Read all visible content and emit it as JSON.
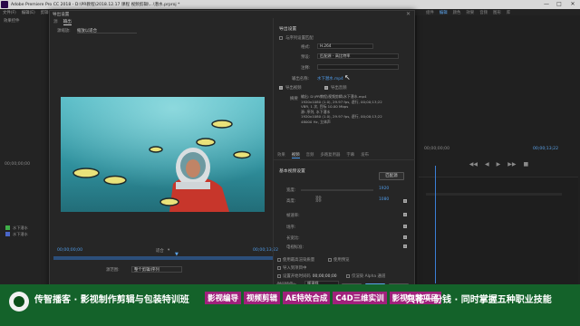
{
  "app": {
    "title": "Adobe Premiere Pro CC 2018 - D:\\PR教程\\2018.12.17 课程 视频剪辑\\...\\潜水.prproj *",
    "window_controls": [
      "—",
      "□",
      "✕"
    ]
  },
  "menu": [
    "文件(F)",
    "编辑(E)",
    "剪辑(C)",
    "序列(S)",
    "标记(M)",
    "图形(G)",
    "窗口(W)",
    "帮助(H)"
  ],
  "workspace_tabs": [
    {
      "label": "组件",
      "active": false
    },
    {
      "label": "编辑",
      "active": true
    },
    {
      "label": "颜色",
      "active": false
    },
    {
      "label": "效果",
      "active": false
    },
    {
      "label": "音频",
      "active": false
    },
    {
      "label": "图形",
      "active": false
    },
    {
      "label": "库",
      "active": false
    }
  ],
  "left_panel": {
    "tab": "效果控件",
    "timecode": "00;00;00;00",
    "project_items": [
      {
        "color": "#3fae49",
        "label": "水下潜水"
      },
      {
        "color": "#4a66c9",
        "label": "水下潜水"
      }
    ]
  },
  "right_panel": {
    "timecode_left": "00;00;00;00",
    "timecode_right": "00;00;13;22",
    "transport_icons": [
      "◀◀",
      "◀",
      "▶",
      "▶▶",
      "■"
    ]
  },
  "dialog": {
    "title": "导出设置",
    "close": "✕",
    "tabs": [
      {
        "label": "源",
        "active": false
      },
      {
        "label": "输出",
        "active": true
      }
    ],
    "source_scale": {
      "label": "源缩放:",
      "value": "缩放以适合"
    },
    "scrub": {
      "tc_left": "00;00;00;00",
      "tc_right": "00;00;13;22",
      "fit_label": "适合",
      "source_range_label": "源范围:",
      "source_range_value": "整个剪辑/序列"
    },
    "export_settings": {
      "section_title": "导出设置",
      "match_sequence_label": "与序列设置匹配",
      "format_label": "格式:",
      "format_value": "H.264",
      "preset_label": "预设:",
      "preset_value": "匹配源 - 高比特率",
      "comments_label": "注释:",
      "output_name_label": "输出名称:",
      "output_name_value": "水下潜水.mp4",
      "export_video_label": "导出视频",
      "export_audio_label": "导出音频",
      "summary_title": "摘要",
      "summary_lines": [
        "输出: D:\\PR教程\\视频剪辑\\水下潜水.mp4",
        "1920x1080 (1.0), 29.97 fps, 逐行, 00;00;13;22",
        "VBR, 1 次, 目标 10.00 Mbps",
        "源: 序列, 水下潜水",
        "1920x1080 (1.0), 29.97 fps, 逐行, 00;00;13;22",
        "48000 Hz, 立体声"
      ]
    },
    "sub_tabs": [
      {
        "label": "效果",
        "active": false
      },
      {
        "label": "视频",
        "active": true
      },
      {
        "label": "音频",
        "active": false
      },
      {
        "label": "多路复用器",
        "active": false
      },
      {
        "label": "字幕",
        "active": false
      },
      {
        "label": "发布",
        "active": false
      }
    ],
    "video_section": {
      "title": "基本视频设置",
      "match_source_button": "匹配源",
      "width_label": "宽度:",
      "width_value": "1920",
      "height_label": "高度:",
      "height_value": "1080",
      "frame_rate_label": "帧速率:",
      "field_order_label": "场序:",
      "aspect_label": "长宽比:",
      "tv_standard_label": "电视标准:"
    },
    "bottom_options": {
      "max_render_quality": "使用最高渲染质量",
      "use_previews": "使用预览",
      "import_into_project": "导入到项目中",
      "set_start_timecode": "设置开始时间码",
      "start_timecode_value": "00;00;00;00",
      "render_alpha": "仅渲染 Alpha 通道",
      "time_interpolation_label": "时间插值:",
      "time_interpolation_value": "帧采样",
      "metadata_button": "元数据...",
      "queue_button": "队列",
      "export_button": "导出",
      "cancel_button": "取消"
    }
  },
  "banner": {
    "main": "传智播客 · 影视制作剪辑与包装特训班",
    "chips": [
      "影视编导",
      "视频剪辑",
      "AE特效合成",
      "C4D三维实训",
      "影视包装项目"
    ],
    "right": "只花一份钱 · 同时掌握五种职业技能",
    "colors": {
      "background": "#14622a",
      "chip": "#a0217c"
    }
  }
}
